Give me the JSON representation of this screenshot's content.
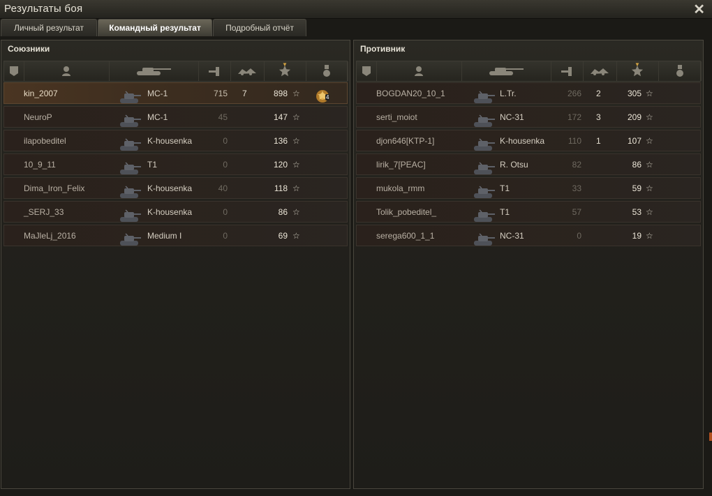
{
  "window": {
    "title": "Результаты боя",
    "close_symbol": "✕"
  },
  "tabs": [
    {
      "label": "Личный результат",
      "active": false
    },
    {
      "label": "Командный результат",
      "active": true
    },
    {
      "label": "Подробный отчёт",
      "active": false
    }
  ],
  "columns": [
    "squad-icon",
    "player-icon",
    "vehicle-icon",
    "damage-icon",
    "kills-icon",
    "experience-icon",
    "medal-icon"
  ],
  "sorted_column": "experience",
  "allies": {
    "title": "Союзники",
    "rows": [
      {
        "player": "kin_2007",
        "tank": "МС-1",
        "damage": "715",
        "kills": "7",
        "xp": "898",
        "medal": true,
        "medal_count": "4",
        "me": true
      },
      {
        "player": "NeuroP",
        "tank": "МС-1",
        "damage": "45",
        "kills": "",
        "xp": "147"
      },
      {
        "player": "ilapobeditel",
        "tank": "K-housenka",
        "damage": "0",
        "kills": "",
        "xp": "136"
      },
      {
        "player": "10_9_11",
        "tank": "T1",
        "damage": "0",
        "kills": "",
        "xp": "120"
      },
      {
        "player": "Dima_Iron_Felix",
        "tank": "K-housenka",
        "damage": "40",
        "kills": "",
        "xp": "118"
      },
      {
        "player": "_SERJ_33",
        "tank": "K-housenka",
        "damage": "0",
        "kills": "",
        "xp": "86"
      },
      {
        "player": "MaJleLj_2016",
        "tank": "Medium I",
        "damage": "0",
        "kills": "",
        "xp": "69"
      }
    ]
  },
  "enemies": {
    "title": "Противник",
    "rows": [
      {
        "player": "BOGDAN20_10_1",
        "tank": "L.Tr.",
        "damage": "266",
        "kills": "2",
        "xp": "305"
      },
      {
        "player": "serti_moiot",
        "tank": "NC-31",
        "damage": "172",
        "kills": "3",
        "xp": "209"
      },
      {
        "player": "djon646[KTP-1]",
        "tank": "K-housenka",
        "damage": "110",
        "kills": "1",
        "xp": "107"
      },
      {
        "player": "lirik_7[PEAC]",
        "tank": "R. Otsu",
        "damage": "82",
        "kills": "",
        "xp": "86"
      },
      {
        "player": "mukola_rmm",
        "tank": "T1",
        "damage": "33",
        "kills": "",
        "xp": "59"
      },
      {
        "player": "Tolik_pobeditel_",
        "tank": "T1",
        "damage": "57",
        "kills": "",
        "xp": "53"
      },
      {
        "player": "serega600_1_1",
        "tank": "NC-31",
        "damage": "0",
        "kills": "",
        "xp": "19"
      }
    ]
  },
  "star_symbol": "☆",
  "colors": {
    "accent": "#d0a040",
    "background": "#1b1a16"
  }
}
